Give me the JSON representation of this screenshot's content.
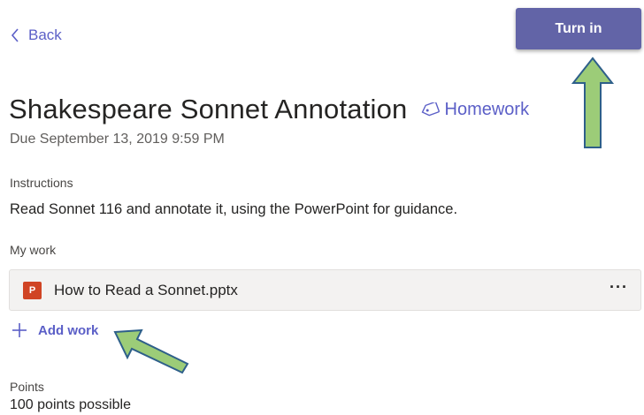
{
  "nav": {
    "back_label": "Back"
  },
  "toolbar": {
    "turn_in_label": "Turn in",
    "accent_color": "#6264a7"
  },
  "assignment": {
    "title": "Shakespeare Sonnet Annotation",
    "category_tag": "Homework",
    "due": "Due September 13, 2019 9:59 PM",
    "instructions_label": "Instructions",
    "instructions_text": "Read Sonnet 116 and annotate it, using the PowerPoint for guidance.",
    "my_work_label": "My work",
    "files": [
      {
        "icon": "powerpoint-icon",
        "icon_letter": "P",
        "name": "How to Read a Sonnet.pptx",
        "more_label": "···"
      }
    ],
    "add_work_label": "Add work",
    "points_label": "Points",
    "points_text": "100 points possible"
  },
  "annotations": {
    "arrow_color": "#9ccc78",
    "arrow_outline": "#2e5f8a"
  }
}
